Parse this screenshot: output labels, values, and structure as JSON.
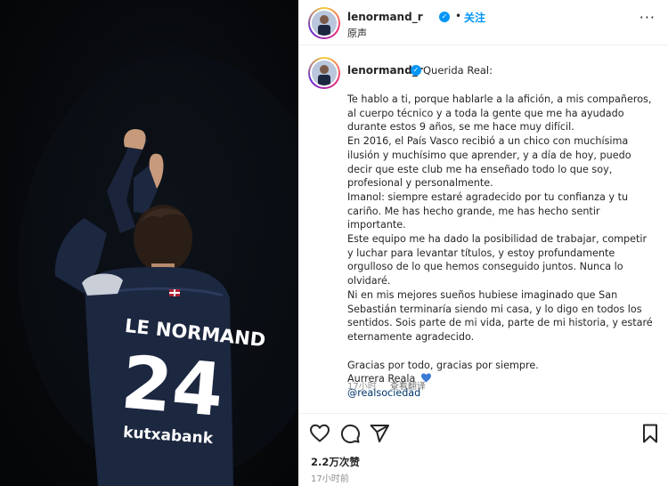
{
  "photo": {
    "jersey_name": "LE NORMAND",
    "jersey_number": "24",
    "sponsor": "kutxabank"
  },
  "header": {
    "username": "lenormand_r",
    "separator": "•",
    "follow_label": "关注",
    "audio_label": "原声",
    "more_label": "···"
  },
  "caption": {
    "username": "lenormand_r",
    "greeting": "Querida Real:",
    "paragraphs": [
      "Te hablo a ti, porque hablarle a la afición, a mis compañeros, al cuerpo técnico y a toda la gente que me ha ayudado durante estos 9 años, se me hace muy difícil.",
      "En 2016, el País Vasco recibió a un chico con muchísima ilusión y muchísimo que aprender, y a día de hoy, puedo decir que este club me ha enseñado todo lo que soy, profesional y personalmente.",
      "Imanol: siempre estaré agradecido por tu confianza y tu cariño. Me has hecho grande, me has hecho sentir importante.",
      "Este equipo me ha dado la posibilidad de trabajar, competir y luchar para levantar títulos, y estoy profundamente orgulloso de lo que hemos conseguido juntos. Nunca lo olvidaré.",
      "Ni en mis mejores sueños hubiese imaginado que San Sebastián terminaría siendo mi casa, y lo digo en todos los sentidos. Sois parte de mi vida, parte de mi historia, y estaré eternamente agradecido."
    ],
    "closing_1": "Gracias por todo, gracias por siempre.",
    "closing_2": "Aurrera Reala",
    "mention": "@realsociedad",
    "time": "17小时",
    "translate_label": "查看翻译"
  },
  "stats": {
    "likes": "2.2万次赞",
    "posted_ago": "17小时前"
  },
  "colors": {
    "accent": "#0095f6",
    "heart": "#3a7bd5",
    "jersey": "#1c2740"
  },
  "icons": [
    "heart-icon",
    "comment-icon",
    "share-icon",
    "bookmark-icon",
    "more-icon",
    "verified-icon"
  ]
}
